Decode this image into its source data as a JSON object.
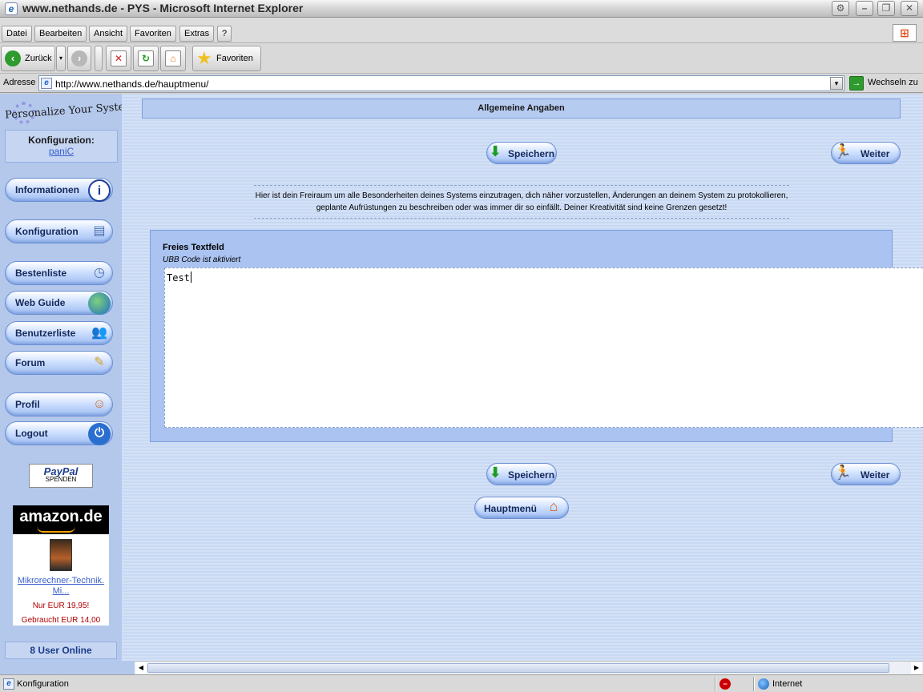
{
  "window": {
    "title": "www.nethands.de - PYS - Microsoft Internet Explorer",
    "controls": [
      "⚙",
      "–",
      "❐",
      "✕"
    ]
  },
  "menu": [
    "Datei",
    "Bearbeiten",
    "Ansicht",
    "Favoriten",
    "Extras",
    "?"
  ],
  "toolbar": {
    "back_label": "Zurück",
    "favorites_label": "Favoriten"
  },
  "address": {
    "label": "Adresse",
    "url": "http://www.nethands.de/hauptmenu/",
    "go_label": "Wechseln zu"
  },
  "sidebar": {
    "logo_text": "Personalize Your System",
    "config_title": "Konfiguration:",
    "config_user": "paniC",
    "nav": [
      {
        "label": "Informationen",
        "icon": "info-icon"
      },
      {
        "label": "Konfiguration",
        "icon": "computer-icon"
      },
      {
        "label": "Bestenliste",
        "icon": "ranking-icon"
      },
      {
        "label": "Web Guide",
        "icon": "globe-icon"
      },
      {
        "label": "Benutzerliste",
        "icon": "users-icon"
      },
      {
        "label": "Forum",
        "icon": "forum-icon"
      },
      {
        "label": "Profil",
        "icon": "profile-icon"
      },
      {
        "label": "Logout",
        "icon": "power-icon"
      }
    ],
    "paypal": {
      "brand": "PayPal",
      "action": "SPENDEN"
    },
    "amazon": {
      "brand": "amazon.de",
      "book_title": "Mikrorechner-Technik. Mi...",
      "price": "Nur EUR 19,95!",
      "used": "Gebraucht EUR 14,00"
    },
    "online": "8 User Online"
  },
  "main": {
    "header": "Allgemeine Angaben",
    "save_label": "Speichern",
    "next_label": "Weiter",
    "home_label": "Hauptmenü",
    "info_text": "Hier ist dein Freiraum um alle Besonderheiten deines Systems einzutragen, dich näher vorzustellen, Änderungen an deinem System zu protokollieren, geplante Aufrüstungen zu beschreiben oder was immer dir so einfällt. Deiner Kreativität sind keine Grenzen gesetzt!",
    "textfield_label": "Freies Textfeld",
    "textfield_sub": "UBB Code ist aktiviert",
    "textfield_value": "Test"
  },
  "status": {
    "text": "Konfiguration",
    "zone": "Internet"
  },
  "colors": {
    "sidebar_bg": "#b4c8ec",
    "content_bg": "#cddcf5",
    "button_text": "#14285a",
    "link": "#3a5fcd"
  }
}
